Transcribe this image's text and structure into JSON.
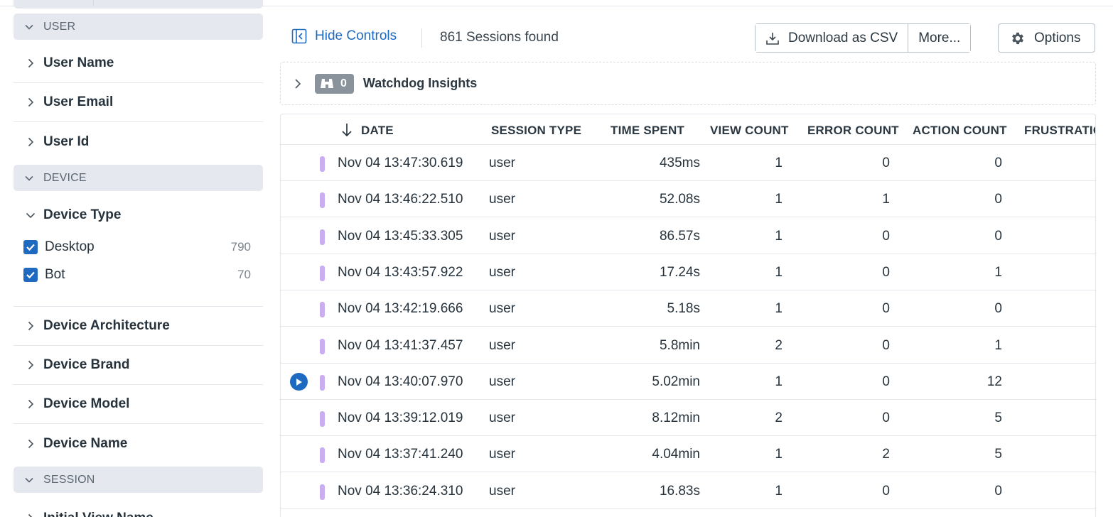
{
  "sidebar": {
    "groups": {
      "user": {
        "label": "USER"
      },
      "device": {
        "label": "DEVICE"
      },
      "session": {
        "label": "SESSION"
      }
    },
    "user_facets": [
      {
        "label": "User Name"
      },
      {
        "label": "User Email"
      },
      {
        "label": "User Id"
      }
    ],
    "device_type": {
      "label": "Device Type",
      "values": [
        {
          "label": "Desktop",
          "count": "790",
          "checked": true
        },
        {
          "label": "Bot",
          "count": "70",
          "checked": true
        }
      ]
    },
    "device_facets": [
      {
        "label": "Device Architecture"
      },
      {
        "label": "Device Brand"
      },
      {
        "label": "Device Model"
      },
      {
        "label": "Device Name"
      }
    ],
    "session_facets": [
      {
        "label": "Initial View Name"
      }
    ]
  },
  "toolbar": {
    "hide_controls_label": "Hide Controls",
    "sessions_found": "861 Sessions found",
    "download_label": "Download as CSV",
    "more_label": "More...",
    "options_label": "Options"
  },
  "insights": {
    "count": "0",
    "label": "Watchdog Insights"
  },
  "table": {
    "columns": [
      "DATE",
      "SESSION TYPE",
      "TIME SPENT",
      "VIEW COUNT",
      "ERROR COUNT",
      "ACTION COUNT",
      "FRUSTRATIO"
    ],
    "sort": {
      "column": "DATE",
      "direction": "desc"
    },
    "rows": [
      {
        "date": "Nov 04 13:47:30.619",
        "type": "user",
        "time": "435ms",
        "views": "1",
        "errors": "0",
        "actions": "0",
        "replay": false
      },
      {
        "date": "Nov 04 13:46:22.510",
        "type": "user",
        "time": "52.08s",
        "views": "1",
        "errors": "1",
        "actions": "0",
        "replay": false
      },
      {
        "date": "Nov 04 13:45:33.305",
        "type": "user",
        "time": "86.57s",
        "views": "1",
        "errors": "0",
        "actions": "0",
        "replay": false
      },
      {
        "date": "Nov 04 13:43:57.922",
        "type": "user",
        "time": "17.24s",
        "views": "1",
        "errors": "0",
        "actions": "1",
        "replay": false
      },
      {
        "date": "Nov 04 13:42:19.666",
        "type": "user",
        "time": "5.18s",
        "views": "1",
        "errors": "0",
        "actions": "0",
        "replay": false
      },
      {
        "date": "Nov 04 13:41:37.457",
        "type": "user",
        "time": "5.8min",
        "views": "2",
        "errors": "0",
        "actions": "1",
        "replay": false
      },
      {
        "date": "Nov 04 13:40:07.970",
        "type": "user",
        "time": "5.02min",
        "views": "1",
        "errors": "0",
        "actions": "12",
        "replay": true
      },
      {
        "date": "Nov 04 13:39:12.019",
        "type": "user",
        "time": "8.12min",
        "views": "2",
        "errors": "0",
        "actions": "5",
        "replay": false
      },
      {
        "date": "Nov 04 13:37:41.240",
        "type": "user",
        "time": "4.04min",
        "views": "1",
        "errors": "2",
        "actions": "5",
        "replay": false
      },
      {
        "date": "Nov 04 13:36:24.310",
        "type": "user",
        "time": "16.83s",
        "views": "1",
        "errors": "0",
        "actions": "0",
        "replay": false
      }
    ]
  },
  "colors": {
    "accent": "#1e6ac1",
    "row_marker": "#c9aef0",
    "group_header_bg": "#e6e8f0",
    "insights_badge": "#8a939b"
  },
  "icons": {
    "hide_controls": "collapse-panel-icon",
    "download": "download-icon",
    "options": "gear-icon",
    "insights": "binoculars-icon",
    "sort": "arrow-down-icon",
    "replay": "play-icon",
    "check": "check-icon",
    "chevrons": [
      "chevron-down-icon",
      "chevron-right-icon"
    ]
  }
}
